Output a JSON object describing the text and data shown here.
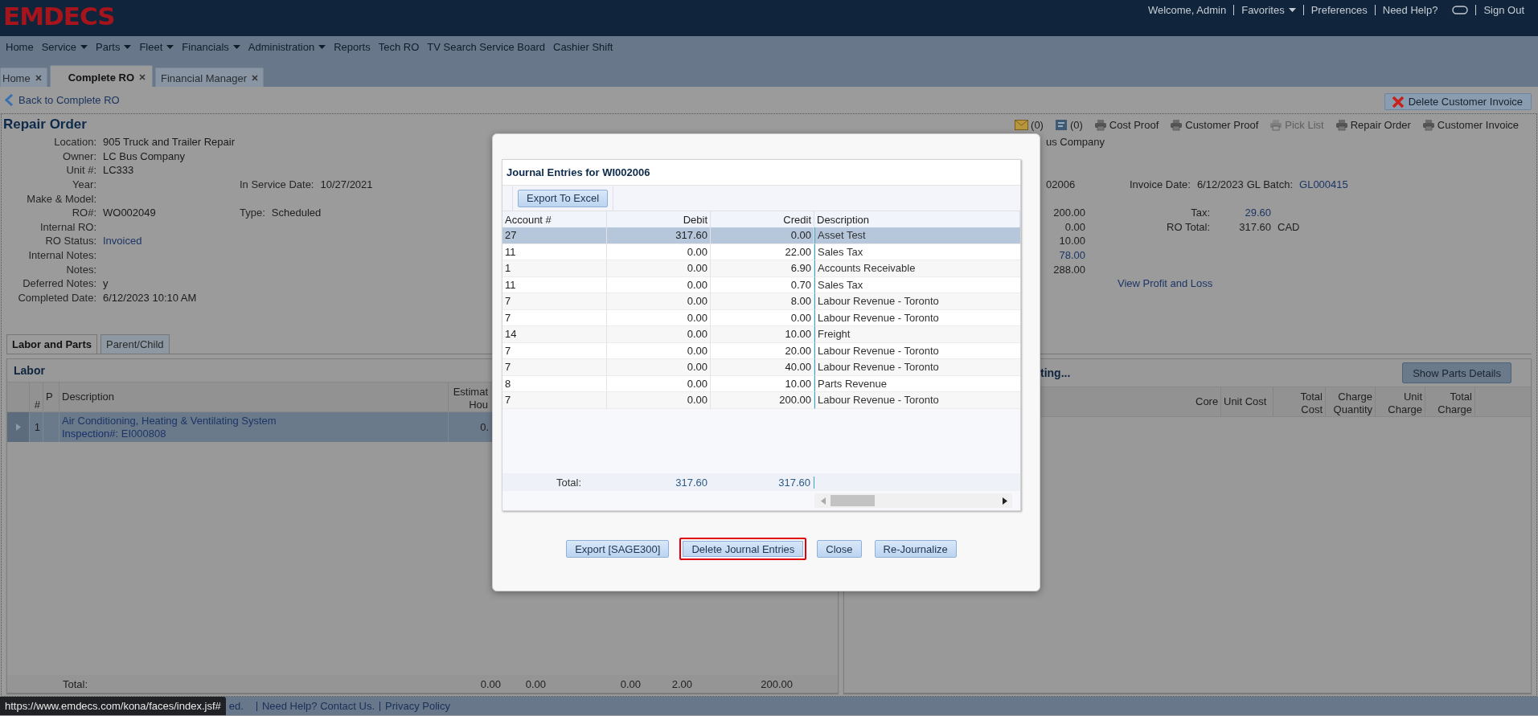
{
  "header": {
    "logo": "EMDECS",
    "links": [
      {
        "kind": "text",
        "label": "Welcome, Admin"
      },
      {
        "kind": "dropdown",
        "label": "Favorites"
      },
      {
        "kind": "link",
        "label": "Preferences"
      },
      {
        "kind": "link",
        "label": "Need Help?"
      },
      {
        "kind": "chat"
      },
      {
        "kind": "link",
        "label": "Sign Out"
      }
    ]
  },
  "menu": [
    {
      "label": "Home",
      "dropdown": false
    },
    {
      "label": "Service",
      "dropdown": true
    },
    {
      "label": "Parts",
      "dropdown": true
    },
    {
      "label": "Fleet",
      "dropdown": true
    },
    {
      "label": "Financials",
      "dropdown": true
    },
    {
      "label": "Administration",
      "dropdown": true
    },
    {
      "label": "Reports",
      "dropdown": false
    },
    {
      "label": "Tech RO",
      "dropdown": false
    },
    {
      "label": "TV Search Service Board",
      "dropdown": false
    },
    {
      "label": "Cashier Shift",
      "dropdown": false
    }
  ],
  "tabs": [
    {
      "label": "Home",
      "selected": false
    },
    {
      "label": "Complete RO",
      "selected": true
    },
    {
      "label": "Financial Manager",
      "selected": false
    }
  ],
  "back_link": "Back to Complete RO",
  "delete_invoice_button": "Delete Customer Invoice",
  "repair_order": {
    "title": "Repair Order",
    "toolbar": [
      {
        "kind": "mail",
        "label": "(0)",
        "disabled": false
      },
      {
        "kind": "document",
        "label": "(0)",
        "disabled": false
      },
      {
        "kind": "print",
        "label": "Cost Proof",
        "disabled": false
      },
      {
        "kind": "print",
        "label": "Customer Proof",
        "disabled": false
      },
      {
        "kind": "print",
        "label": "Pick List",
        "disabled": true
      },
      {
        "kind": "print",
        "label": "Repair Order",
        "disabled": false
      },
      {
        "kind": "print",
        "label": "Customer Invoice",
        "disabled": false
      }
    ],
    "fields": [
      {
        "label": "Location:",
        "value": "905 Truck and Trailer Repair",
        "link": false
      },
      {
        "label": "Owner:",
        "value": "LC Bus Company",
        "link": false
      },
      {
        "label": "Unit #:",
        "value": "LC333",
        "link": false
      },
      {
        "label": "Year:",
        "extra_label": "In Service Date:",
        "extra_value": "10/27/2021",
        "link": false
      },
      {
        "label": "Make & Model:"
      },
      {
        "label": "RO#:",
        "value": "WO002049",
        "extra_label": "Type:",
        "extra_value": "Scheduled",
        "link": false
      },
      {
        "label": "Internal RO:"
      },
      {
        "label": "RO Status:",
        "value": "Invoiced",
        "link": true
      },
      {
        "label": "Internal Notes:"
      },
      {
        "label": "Notes:"
      },
      {
        "label": "Deferred Notes:",
        "value": "y",
        "link": false
      },
      {
        "label": "Completed Date:",
        "value": "6/12/2023 10:10 AM",
        "link": false
      }
    ],
    "summary": {
      "owner_fragment": "us Company",
      "invoice_fragment": "02006",
      "invoice_date_label": "Invoice Date:",
      "invoice_date": "6/12/2023",
      "gl_batch_label": "GL Batch:",
      "gl_batch": "GL000415",
      "amounts": [
        {
          "value": "200.00",
          "link": false
        },
        {
          "value": "0.00",
          "link": false
        },
        {
          "value": "10.00",
          "link": false
        },
        {
          "value": "78.00",
          "link": true
        },
        {
          "value": "288.00",
          "link": false
        }
      ],
      "tax_label": "Tax:",
      "tax": "29.60",
      "ro_total_label": "RO Total:",
      "ro_total": "317.60",
      "currency": "CAD",
      "profit_link": "View Profit and Loss"
    }
  },
  "lower_tabs": [
    {
      "label": "Labor and Parts",
      "selected": true
    },
    {
      "label": "Parent/Child",
      "selected": false
    }
  ],
  "labor": {
    "title": "Labor",
    "columns": [
      {
        "lines": [
          "#"
        ]
      },
      {
        "lines": [
          "P"
        ]
      },
      {
        "lines": [
          "Description"
        ]
      },
      {
        "lines": [
          "Estimat",
          "Hou"
        ]
      }
    ],
    "rows": [
      {
        "number": "1",
        "description": "Air Conditioning, Heating & Ventilating System",
        "inspection_label": "Inspection#:",
        "inspection": "EI000808",
        "hours": "0.",
        "selected": true
      }
    ],
    "total_label": "Total:",
    "totals": [
      "0.00",
      "0.00",
      "0.00",
      "2.00",
      "200.00"
    ]
  },
  "parts": {
    "title_fragment": "ting...",
    "button": "Show Parts Details",
    "columns": [
      {
        "lines": [
          "Core"
        ]
      },
      {
        "lines": [
          "Unit Cost"
        ]
      },
      {
        "lines": [
          "Total",
          "Cost"
        ]
      },
      {
        "lines": [
          "Charge",
          "Quantity"
        ]
      },
      {
        "lines": [
          "Unit",
          "Charge"
        ]
      },
      {
        "lines": [
          "Total",
          "Charge"
        ]
      }
    ]
  },
  "journal": {
    "title": "Journal Entries for WI002006",
    "export_excel": "Export To Excel",
    "columns": [
      "Account #",
      "Debit",
      "Credit",
      "Description"
    ],
    "rows": [
      {
        "account": "27",
        "debit": "317.60",
        "credit": "0.00",
        "description": "Asset Test",
        "selected": true
      },
      {
        "account": "11",
        "debit": "0.00",
        "credit": "22.00",
        "description": "Sales Tax",
        "selected": false
      },
      {
        "account": "1",
        "debit": "0.00",
        "credit": "6.90",
        "description": "Accounts Receivable",
        "selected": false
      },
      {
        "account": "11",
        "debit": "0.00",
        "credit": "0.70",
        "description": "Sales Tax",
        "selected": false
      },
      {
        "account": "7",
        "debit": "0.00",
        "credit": "8.00",
        "description": "Labour Revenue - Toronto",
        "selected": false
      },
      {
        "account": "7",
        "debit": "0.00",
        "credit": "0.00",
        "description": "Labour Revenue - Toronto",
        "selected": false
      },
      {
        "account": "14",
        "debit": "0.00",
        "credit": "10.00",
        "description": "Freight",
        "selected": false
      },
      {
        "account": "7",
        "debit": "0.00",
        "credit": "20.00",
        "description": "Labour Revenue - Toronto",
        "selected": false
      },
      {
        "account": "7",
        "debit": "0.00",
        "credit": "40.00",
        "description": "Labour Revenue - Toronto",
        "selected": false
      },
      {
        "account": "8",
        "debit": "0.00",
        "credit": "10.00",
        "description": "Parts Revenue",
        "selected": false
      },
      {
        "account": "7",
        "debit": "0.00",
        "credit": "200.00",
        "description": "Labour Revenue - Toronto",
        "selected": false
      }
    ],
    "total_label": "Total:",
    "total_debit": "317.60",
    "total_credit": "317.60",
    "buttons": [
      {
        "label": "Export [SAGE300]",
        "highlighted": false
      },
      {
        "label": "Delete Journal Entries",
        "highlighted": true
      },
      {
        "label": "Close",
        "highlighted": false
      },
      {
        "label": "Re-Journalize",
        "highlighted": false
      }
    ]
  },
  "footer": {
    "tooltip": "https://www.emdecs.com/kona/faces/index.jsf#",
    "fragment": "ed.",
    "links": [
      "Need Help? Contact Us.",
      "Privacy Policy"
    ]
  }
}
